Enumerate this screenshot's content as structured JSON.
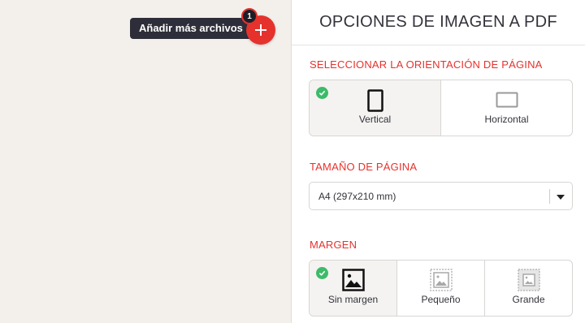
{
  "left": {
    "tooltip": "Añadir más archivos",
    "file_count": "1",
    "add_icon": "plus-icon"
  },
  "panel": {
    "title": "OPCIONES DE IMAGEN A PDF",
    "orientation": {
      "label": "SELECCIONAR LA ORIENTACIÓN DE PÁGINA",
      "options": [
        {
          "label": "Vertical",
          "icon": "portrait-page-icon",
          "selected": true
        },
        {
          "label": "Horizontal",
          "icon": "landscape-page-icon",
          "selected": false
        }
      ]
    },
    "page_size": {
      "label": "TAMAÑO DE PÁGINA",
      "value": "A4 (297x210 mm)"
    },
    "margin": {
      "label": "MARGEN",
      "options": [
        {
          "label": "Sin margen",
          "icon": "no-margin-image-icon",
          "selected": true
        },
        {
          "label": "Pequeño",
          "icon": "small-margin-image-icon",
          "selected": false
        },
        {
          "label": "Grande",
          "icon": "large-margin-image-icon",
          "selected": false
        }
      ]
    }
  },
  "colors": {
    "accent": "#e5322d",
    "check": "#3cbb69",
    "tooltip_bg": "#2e2e3a"
  }
}
